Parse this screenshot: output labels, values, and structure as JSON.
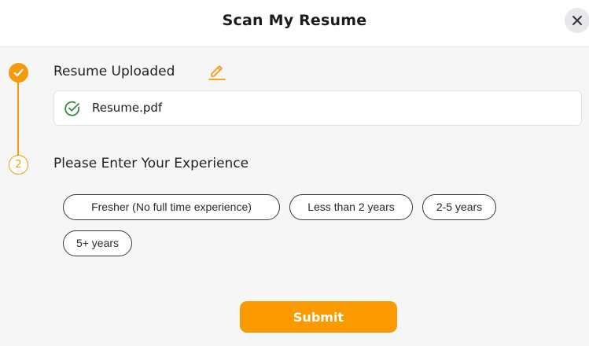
{
  "header": {
    "title": "Scan My Resume",
    "close_icon": "close-icon"
  },
  "steps": [
    {
      "marker_icon": "checkmark-icon",
      "label": "Resume Uploaded",
      "edit_icon": "pencil-icon",
      "status": "complete"
    },
    {
      "number": "2",
      "label": "Please Enter Your Experience",
      "status": "current"
    }
  ],
  "file": {
    "icon": "check-circle-icon",
    "name": "Resume.pdf"
  },
  "experience_options": [
    "Fresher (No full time experience)",
    "Less than 2 years",
    "2-5 years",
    "5+ years"
  ],
  "submit_label": "Submit",
  "colors": {
    "accent": "#f59a0b",
    "success": "#2e8b3e",
    "submit": "#fa9a00"
  }
}
